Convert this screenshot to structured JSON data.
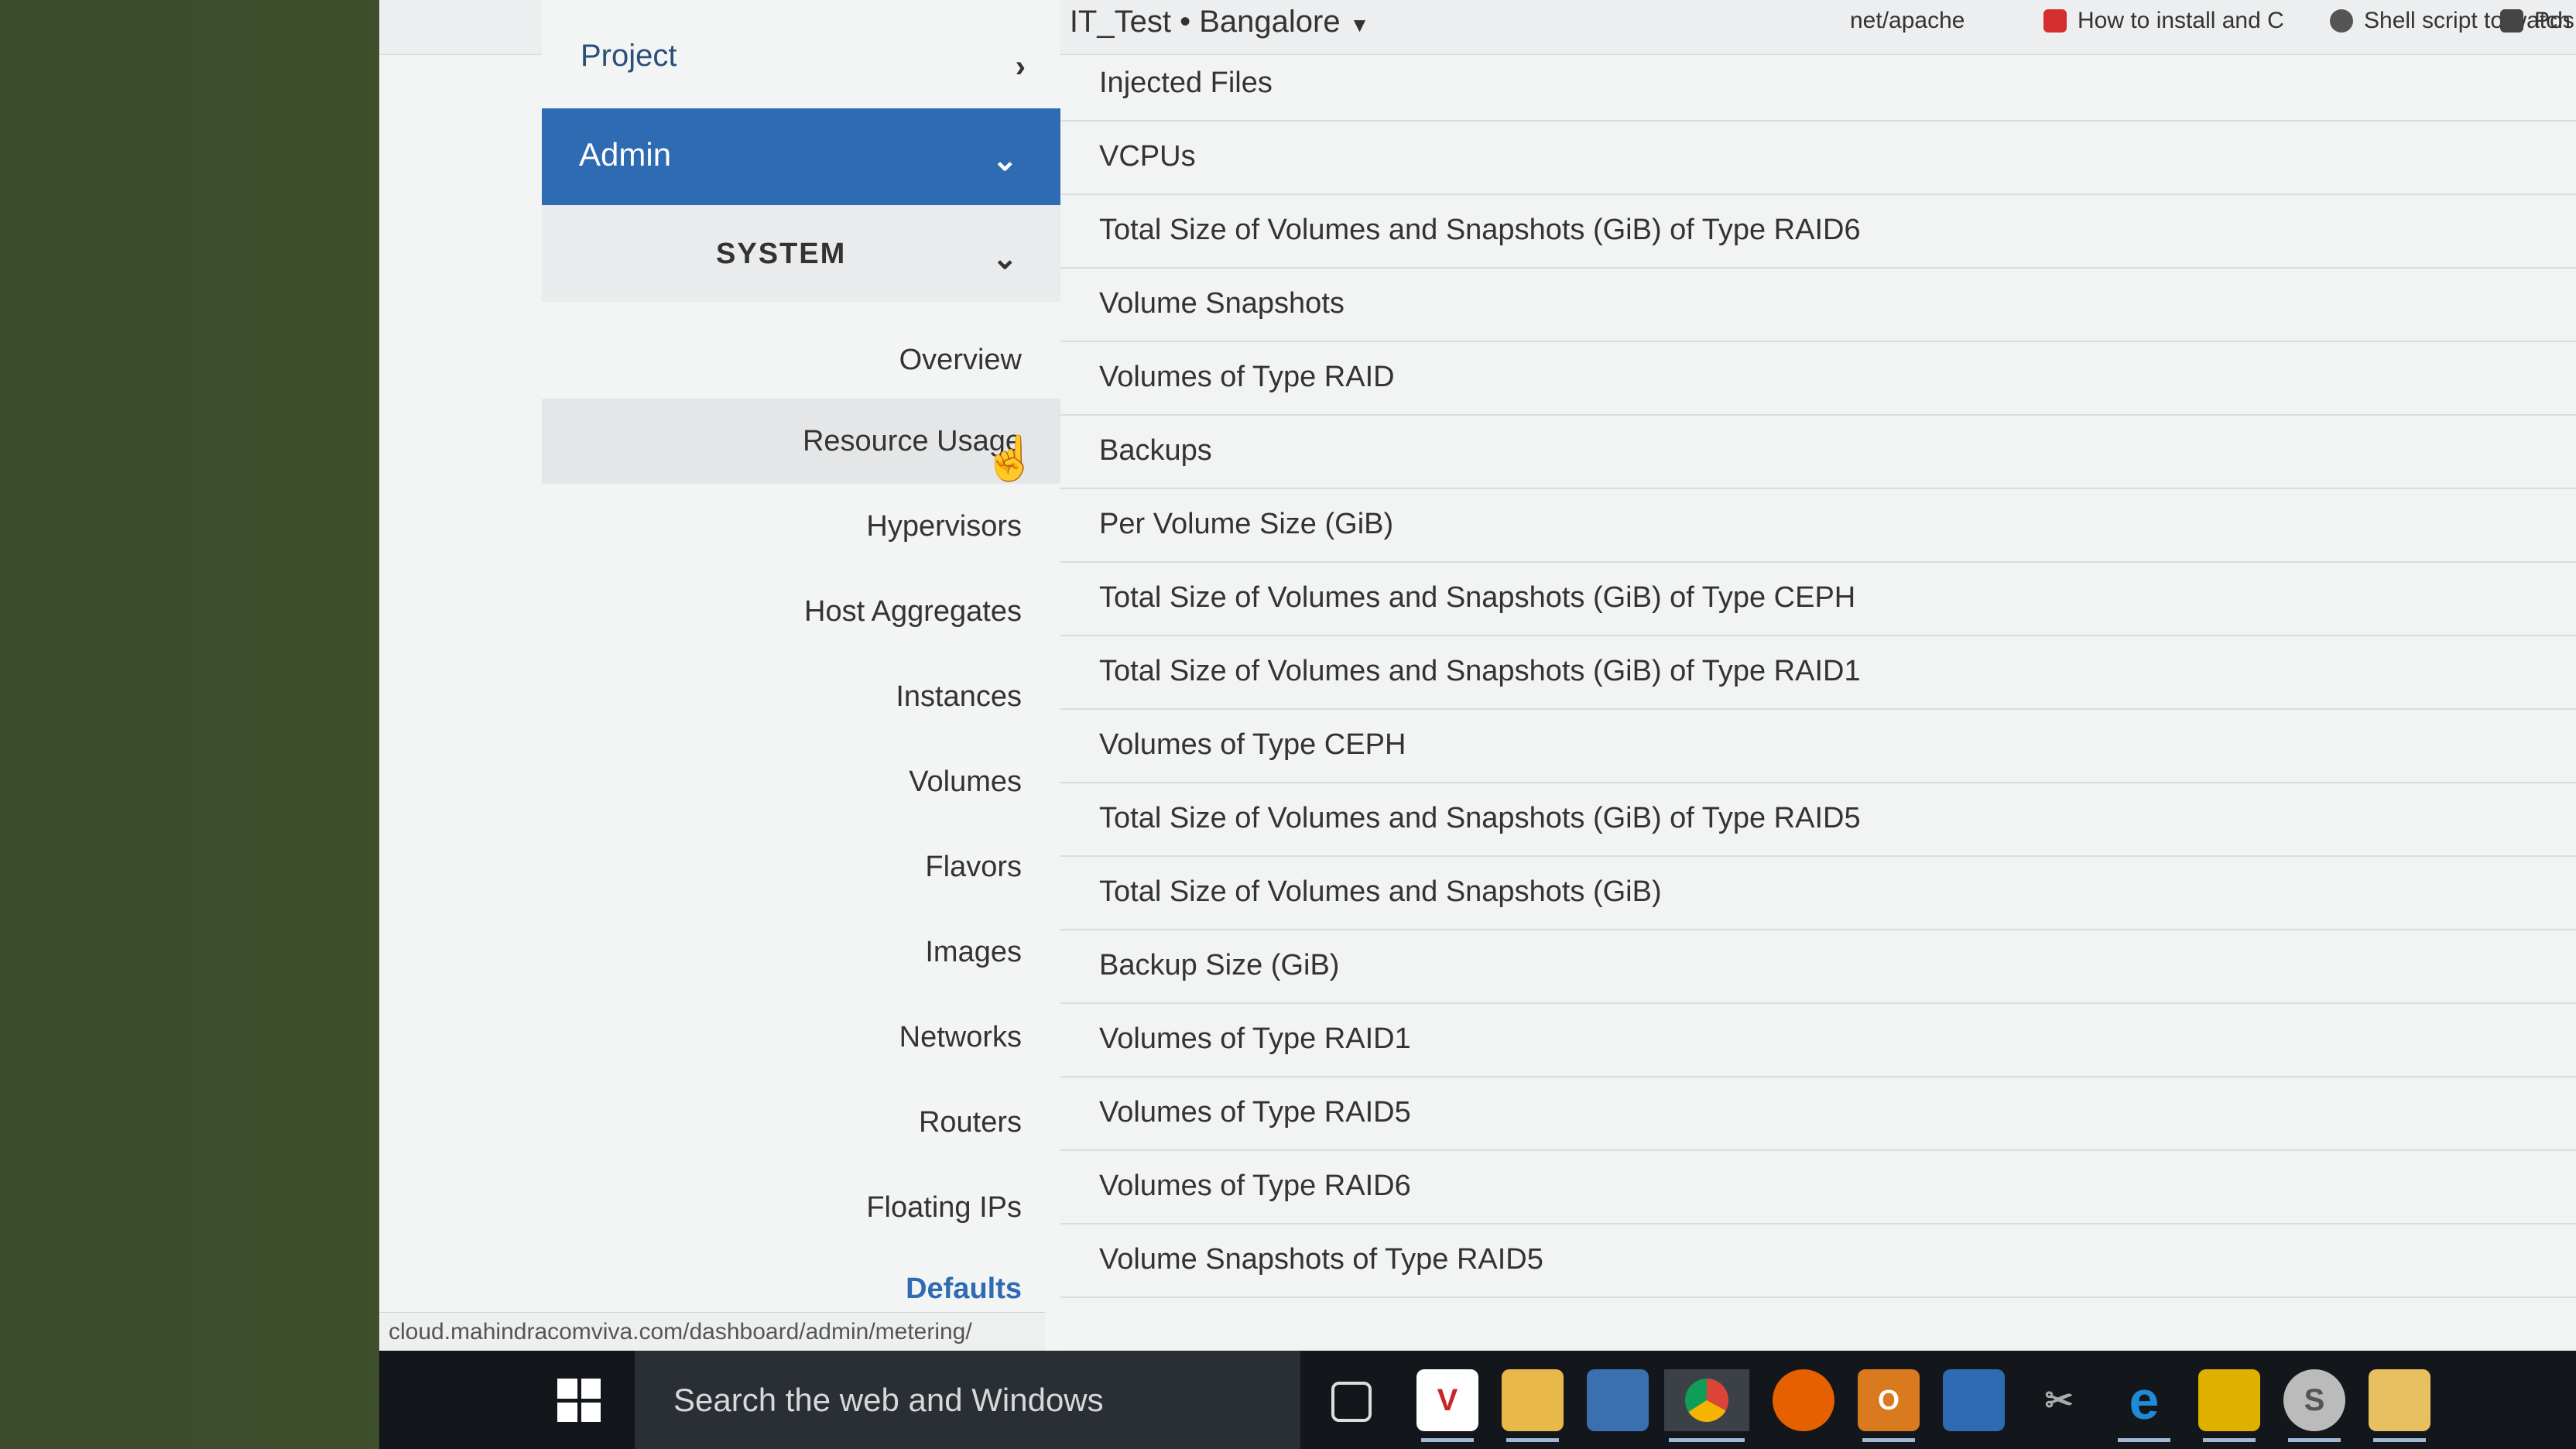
{
  "topbar": {
    "context": "Comviva • IT_Test • Bangalore",
    "bookmarks": [
      {
        "label": "net/apache",
        "color": "#8aa"
      },
      {
        "label": "How to install and C",
        "color": "#d32f2f"
      },
      {
        "label": "Shell script to watch",
        "color": "#555"
      },
      {
        "label": "Pos",
        "color": "#444"
      }
    ]
  },
  "sidebar": {
    "project": "Project",
    "admin": "Admin",
    "system": "SYSTEM",
    "items": [
      {
        "label": "Overview"
      },
      {
        "label": "Resource Usage"
      },
      {
        "label": "Hypervisors"
      },
      {
        "label": "Host Aggregates"
      },
      {
        "label": "Instances"
      },
      {
        "label": "Volumes"
      },
      {
        "label": "Flavors"
      },
      {
        "label": "Images"
      },
      {
        "label": "Networks"
      },
      {
        "label": "Routers"
      },
      {
        "label": "Floating IPs"
      },
      {
        "label": "Defaults"
      }
    ],
    "active_item": "Resource Usage"
  },
  "metrics": [
    "Injected Files",
    "VCPUs",
    "Total Size of Volumes and Snapshots (GiB) of Type RAID6",
    "Volume Snapshots",
    "Volumes of Type RAID",
    "Backups",
    "Per Volume Size (GiB)",
    "Total Size of Volumes and Snapshots (GiB) of Type CEPH",
    "Total Size of Volumes and Snapshots (GiB) of Type RAID1",
    "Volumes of Type CEPH",
    "Total Size of Volumes and Snapshots (GiB) of Type RAID5",
    "Total Size of Volumes and Snapshots (GiB)",
    "Backup Size (GiB)",
    "Volumes of Type RAID1",
    "Volumes of Type RAID5",
    "Volumes of Type RAID6",
    "Volume Snapshots of Type RAID5"
  ],
  "status_url": "cloud.mahindracomviva.com/dashboard/admin/metering/",
  "taskbar": {
    "search_placeholder": "Search the web and Windows",
    "apps": [
      {
        "name": "task-view-icon",
        "color": "#13171c"
      },
      {
        "name": "vc-app-icon",
        "color": "#ffffff"
      },
      {
        "name": "file-explorer-icon",
        "color": "#e8b94a"
      },
      {
        "name": "network-app-icon",
        "color": "#3a6fb0"
      },
      {
        "name": "chrome-icon",
        "color": "#3c4148"
      },
      {
        "name": "firefox-icon",
        "color": "#e66000"
      },
      {
        "name": "outlook-icon",
        "color": "#d97a1e"
      },
      {
        "name": "remote-desktop-icon",
        "color": "#2f6bb3"
      },
      {
        "name": "snipping-tool-icon",
        "color": "#13171c"
      },
      {
        "name": "internet-explorer-icon",
        "color": "#1f8ad6"
      },
      {
        "name": "puzzle-app-icon",
        "color": "#e0b000"
      },
      {
        "name": "skype-icon",
        "color": "#bbbbbb"
      },
      {
        "name": "folder-icon",
        "color": "#e8c060"
      }
    ]
  }
}
